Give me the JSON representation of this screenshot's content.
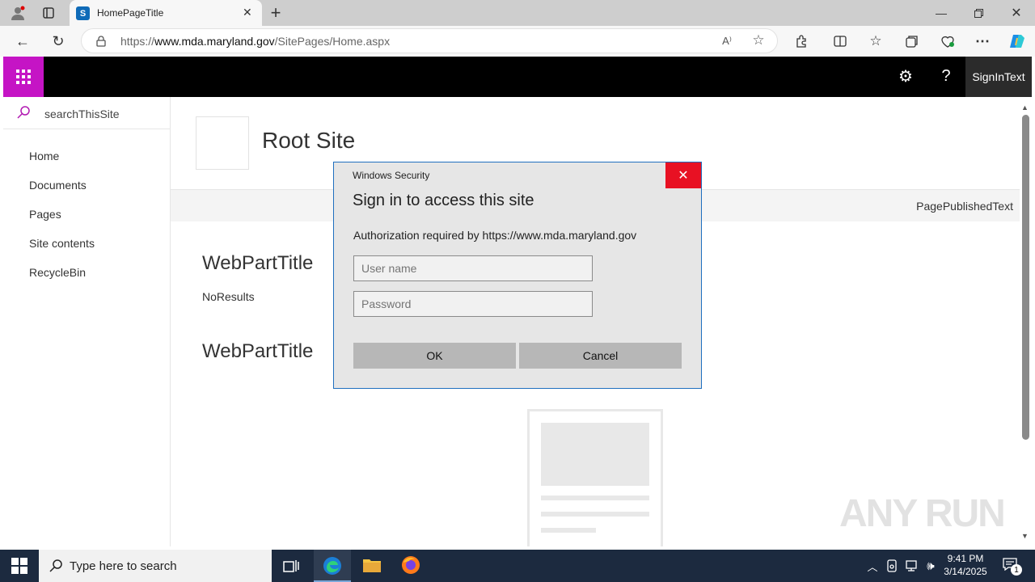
{
  "browser": {
    "tab_title": "HomePageTitle",
    "url_prefix": "https://",
    "url_domain": "www.mda.maryland.gov",
    "url_path": "/SitePages/Home.aspx"
  },
  "topbar": {
    "signin_label": "SignInText",
    "accent_color": "#c514c5"
  },
  "leftnav": {
    "search_placeholder": "searchThisSite",
    "items": [
      {
        "label": "Home"
      },
      {
        "label": "Documents"
      },
      {
        "label": "Pages"
      },
      {
        "label": "Site contents"
      },
      {
        "label": "RecycleBin"
      }
    ]
  },
  "main": {
    "site_title": "Root Site",
    "published_text": "PagePublishedText",
    "webpart1_title": "WebPartTitle",
    "no_results": "NoResults",
    "webpart2_title": "WebPartTitle"
  },
  "dialog": {
    "window_title": "Windows Security",
    "heading": "Sign in to access this site",
    "message": "Authorization required by https://www.mda.maryland.gov",
    "username_placeholder": "User name",
    "password_placeholder": "Password",
    "ok_label": "OK",
    "cancel_label": "Cancel"
  },
  "taskbar": {
    "search_placeholder": "Type here to search",
    "time": "9:41 PM",
    "date": "3/14/2025",
    "notification_count": "1"
  },
  "watermark": "ANY RUN"
}
